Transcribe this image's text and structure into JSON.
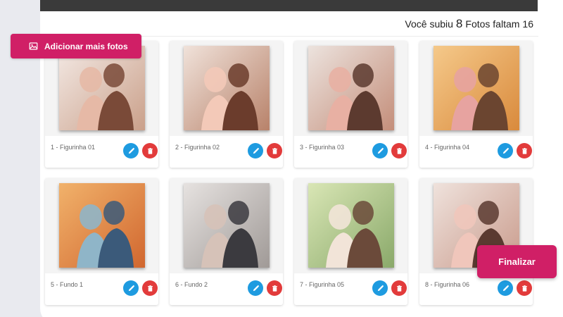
{
  "header": {
    "counter_prefix": "Você subiu",
    "uploaded_count": "8",
    "counter_middle": "Fotos faltam",
    "remaining_count": "16"
  },
  "add_button": {
    "label": "Adicionar mais fotos",
    "icon": "image-icon"
  },
  "finalize_button": {
    "label": "Finalizar"
  },
  "colors": {
    "accent": "#d01f66",
    "edit": "#1e9be0",
    "delete": "#e23b3b",
    "topbar": "#3a3a3a"
  },
  "photos": [
    {
      "label": "1 - Figurinha 01",
      "palette": [
        "#f3e9e4",
        "#caa08a",
        "#7a4a38",
        "#e6b9a6"
      ]
    },
    {
      "label": "2 - Figurinha 02",
      "palette": [
        "#f0e2da",
        "#b8826a",
        "#6b3c2c",
        "#f3c9b8"
      ]
    },
    {
      "label": "3 - Figurinha 03",
      "palette": [
        "#ece3de",
        "#c48e7a",
        "#5c3a2f",
        "#e8b0a3"
      ]
    },
    {
      "label": "4 - Figurinha 04",
      "palette": [
        "#f5c98a",
        "#d98a3c",
        "#6b4530",
        "#e7a3a0"
      ]
    },
    {
      "label": "5 - Fundo 1",
      "palette": [
        "#f1b26b",
        "#d1672f",
        "#3b5a7a",
        "#8fb5c8"
      ]
    },
    {
      "label": "6 - Fundo 2",
      "palette": [
        "#e6e2e0",
        "#a09a97",
        "#3b3a3f",
        "#d6c2b8"
      ]
    },
    {
      "label": "7 - Figurinha 05",
      "palette": [
        "#d9e6b5",
        "#8aa96a",
        "#6b4a3a",
        "#f2e4d8"
      ]
    },
    {
      "label": "8 - Figurinha 06",
      "palette": [
        "#efe2dc",
        "#c99b8c",
        "#5a3a30",
        "#f0c6bb"
      ]
    }
  ]
}
